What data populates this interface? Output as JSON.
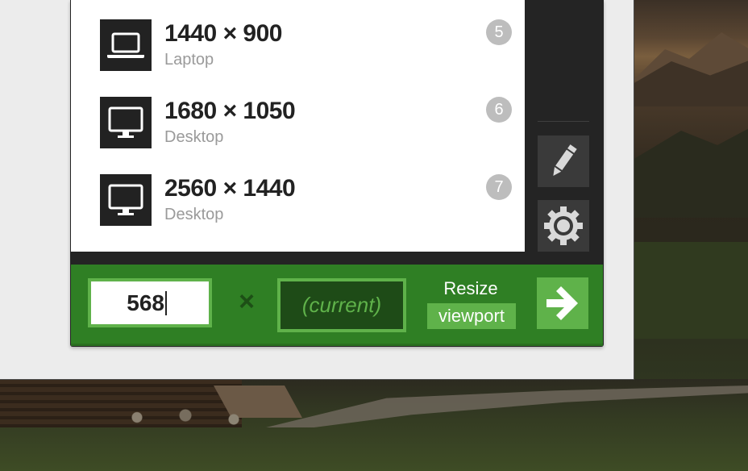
{
  "presets": [
    {
      "resolution": "1440 × 900",
      "device": "Laptop",
      "shortcut": "5",
      "icon": "laptop-icon"
    },
    {
      "resolution": "1680 × 1050",
      "device": "Desktop",
      "shortcut": "6",
      "icon": "desktop-monitor-icon"
    },
    {
      "resolution": "2560 × 1440",
      "device": "Desktop",
      "shortcut": "7",
      "icon": "desktop-monitor-icon"
    }
  ],
  "sidebar": {
    "edit_icon": "pencil-icon",
    "settings_icon": "gear-icon"
  },
  "footer": {
    "width_value": "568",
    "separator": "×",
    "height_placeholder": "(current)",
    "resize_label": "Resize",
    "viewport_label": "viewport",
    "go_icon": "arrow-right-icon"
  },
  "colors": {
    "accent_green": "#5fb24a",
    "footer_green": "#2f7f24",
    "dark_green": "#1e4b17",
    "panel_dark": "#242424",
    "badge_gray": "#bdbdbd"
  }
}
